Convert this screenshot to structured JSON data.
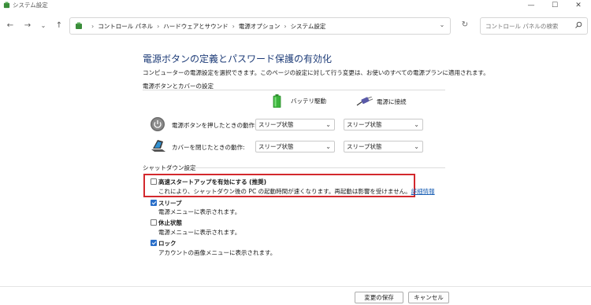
{
  "window": {
    "title": "システム設定"
  },
  "nav": {
    "breadcrumbs": [
      "コントロール パネル",
      "ハードウェアとサウンド",
      "電源オプション",
      "システム設定"
    ],
    "search_placeholder": "コントロール パネルの検索"
  },
  "page": {
    "title": "電源ボタンの定義とパスワード保護の有効化",
    "description": "コンピューターの電源設定を選択できます。このページの設定に対して行う変更は、お使いのすべての電源プランに適用されます。"
  },
  "power_section": {
    "label": "電源ボタンとカバーの設定",
    "columns": [
      "バッテリ駆動",
      "電源に接続"
    ],
    "rows": [
      {
        "label": "電源ボタンを押したときの動作:",
        "battery": "スリープ状態",
        "plugged": "スリープ状態"
      },
      {
        "label": "カバーを閉じたときの動作:",
        "battery": "スリープ状態",
        "plugged": "スリープ状態"
      }
    ]
  },
  "shutdown_section": {
    "label": "シャットダウン設定",
    "options": [
      {
        "label": "高速スタートアップを有効にする (推奨)",
        "desc": "これにより、シャットダウン後の PC の起動時間が速くなります。再起動は影響を受けません。",
        "link": "詳細情報",
        "checked": false
      },
      {
        "label": "スリープ",
        "desc": "電源メニューに表示されます。",
        "checked": true
      },
      {
        "label": "休止状態",
        "desc": "電源メニューに表示されます。",
        "checked": false
      },
      {
        "label": "ロック",
        "desc": "アカウントの画像メニューに表示されます。",
        "checked": true
      }
    ]
  },
  "footer": {
    "save_label": "変更の保存",
    "cancel_label": "キャンセル"
  },
  "colors": {
    "title": "#1e3c78",
    "highlight": "#d3282d",
    "checkbox": "#2a6fc9",
    "link": "#1a5fb4"
  }
}
